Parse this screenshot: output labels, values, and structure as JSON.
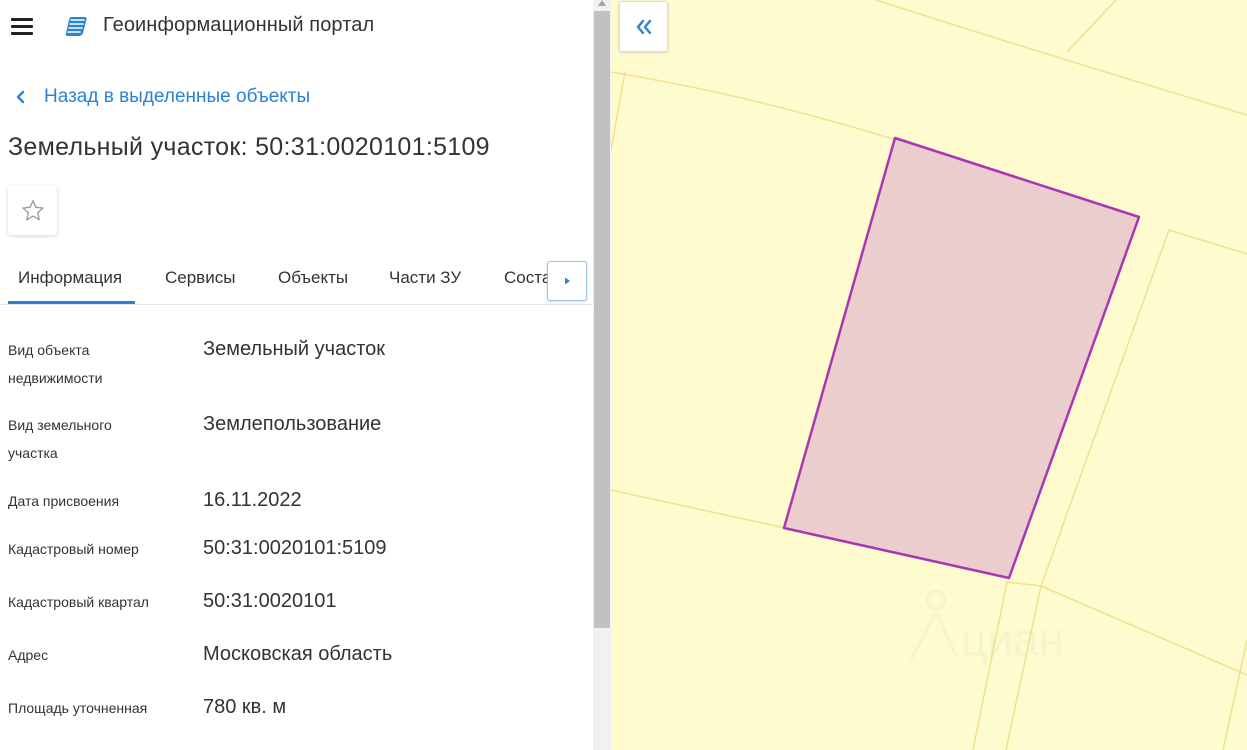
{
  "header": {
    "menu_icon": "hamburger-menu-icon",
    "logo_icon": "geoportal-logo-icon",
    "app_title": "Геоинформационный портал"
  },
  "navigation": {
    "back_icon": "chevron-left-icon",
    "back_label": "Назад в выделенные объекты"
  },
  "object": {
    "title": "Земельный участок: 50:31:0020101:5109",
    "favorite_icon": "star-outline-icon"
  },
  "tabs": {
    "items": [
      {
        "label": "Информация",
        "active": true
      },
      {
        "label": "Сервисы",
        "active": false
      },
      {
        "label": "Объекты",
        "active": false
      },
      {
        "label": "Части ЗУ",
        "active": false
      },
      {
        "label": "Состав ЗУ",
        "active": false
      }
    ],
    "scroll_icon": "caret-right-icon",
    "accent_color": "#2a82d6"
  },
  "properties": [
    {
      "label": "Вид объекта недвижимости",
      "value": "Земельный участок"
    },
    {
      "label": "Вид земельного участка",
      "value": "Землепользование"
    },
    {
      "label": "Дата присвоения",
      "value": "16.11.2022"
    },
    {
      "label": "Кадастровый номер",
      "value": "50:31:0020101:5109"
    },
    {
      "label": "Кадастровый квартал",
      "value": "50:31:0020101"
    },
    {
      "label": "Адрес",
      "value": "Московская область"
    },
    {
      "label": "Площадь уточненная",
      "value": "780 кв. м"
    }
  ],
  "map": {
    "collapse_icon": "double-chevron-left-icon",
    "background_color": "#fefbce",
    "parcel_boundary_color": "#a936b4",
    "parcel_fill_color": "#ebcdcd",
    "neighbor_line_color": "#f1e08f",
    "watermark_text": "циан"
  },
  "colors": {
    "link": "#2a82d6",
    "text": "#333333"
  }
}
